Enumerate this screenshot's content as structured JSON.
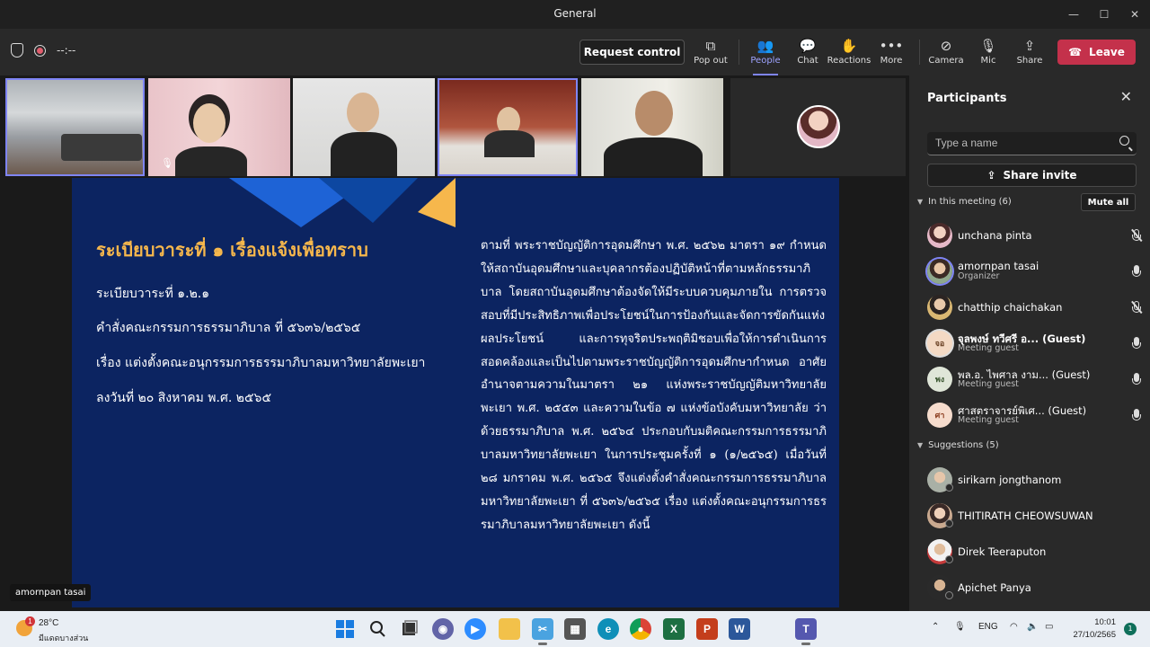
{
  "window": {
    "title": "General"
  },
  "toolbar": {
    "timer": "--:--",
    "request_control": "Request control",
    "buttons": [
      {
        "label": "Pop out",
        "icon": "popout-icon"
      },
      {
        "label": "People",
        "icon": "people-icon"
      },
      {
        "label": "Chat",
        "icon": "chat-icon"
      },
      {
        "label": "Reactions",
        "icon": "reactions-icon"
      },
      {
        "label": "More",
        "icon": "more-icon"
      },
      {
        "label": "Camera",
        "icon": "camera-off-icon"
      },
      {
        "label": "Mic",
        "icon": "mic-off-icon"
      },
      {
        "label": "Share",
        "icon": "share-icon"
      }
    ],
    "leave": "Leave",
    "accent": "#7f85f5",
    "leave_color": "#c4314b"
  },
  "stage": {
    "presenter_label": "amornpan tasai",
    "slide": {
      "title": "ระเบียบวาระที่ ๑ เรื่องแจ้งเพื่อทราบ",
      "lines": [
        "ระเบียบวาระที่ ๑.๒.๑",
        "คำสั่งคณะกรรมการธรรมาภิบาล ที่ ๕๖๓๖/๒๕๖๕",
        "เรื่อง แต่งตั้งคณะอนุกรรมการธรรมาภิบาลมหาวิทยาลัยพะเยา",
        "ลงวันที่ ๒๐ สิงหาคม พ.ศ. ๒๕๖๕"
      ],
      "paragraph": "ตามที่ พระราชบัญญัติการอุดมศึกษา พ.ศ. ๒๕๖๒ มาตรา ๑๙ กำหนดให้สถาบันอุดมศึกษาและบุคลากรต้องปฏิบัติหน้าที่ตามหลักธรรมาภิบาล โดยสถาบันอุดมศึกษาต้องจัดให้มีระบบควบคุมภายใน การตรวจสอบที่มีประสิทธิภาพเพื่อประโยชน์ในการป้องกันและจัดการขัดกันแห่งผลประโยชน์ และการทุจริตประพฤติมิชอบเพื่อให้การดำเนินการสอดคล้องและเป็นไปตามพระราชบัญญัติการอุดมศึกษากำหนด อาศัยอำนาจตามความในมาตรา ๒๑ แห่งพระราชบัญญัติมหาวิทยาลัยพะเยา พ.ศ. ๒๕๕๓ และความในข้อ ๗ แห่งข้อบังคับมหาวิทยาลัย ว่าด้วยธรรมาภิบาล พ.ศ. ๒๕๖๔ ประกอบกับมติคณะกรรมการธรรมาภิบาลมหาวิทยาลัยพะเยา ในการประชุมครั้งที่ ๑ (๑/๒๕๖๕) เมื่อวันที่ ๒๘ มกราคม พ.ศ. ๒๕๖๕ จึงแต่งตั้งคำสั่งคณะกรรมการธรรมาภิบาลมหาวิทยาลัยพะเยา ที่ ๕๖๓๖/๒๕๖๕ เรื่อง แต่งตั้งคณะอนุกรรมการธรรมาภิบาลมหาวิทยาลัยพะเยา ดังนี้",
      "title_color": "#f6b74c",
      "background": "#0c2461"
    }
  },
  "panel": {
    "title": "Participants",
    "search_placeholder": "Type a name",
    "share_invite": "Share invite",
    "in_meeting_header": "In this meeting (6)",
    "mute_all": "Mute all",
    "participants": [
      {
        "name": "unchana pinta",
        "sub": "",
        "initials": "",
        "mic": "off"
      },
      {
        "name": "amornpan tasai",
        "sub": "Organizer",
        "initials": "",
        "mic": "on"
      },
      {
        "name": "chatthip chaichakan",
        "sub": "",
        "initials": "",
        "mic": "off"
      },
      {
        "name": "จุลพงษ์ ทวีศรี อ...  (Guest)",
        "sub": "Meeting guest",
        "initials": "จอ",
        "mic": "on"
      },
      {
        "name": "พล.อ. ไพศาล งาม...  (Guest)",
        "sub": "Meeting guest",
        "initials": "พง",
        "mic": "on"
      },
      {
        "name": "ศาสตราจารย์พิเศ...  (Guest)",
        "sub": "Meeting guest",
        "initials": "ศา",
        "mic": "on"
      }
    ],
    "suggestions_header": "Suggestions (5)",
    "suggestions": [
      {
        "name": "sirikarn jongthanom"
      },
      {
        "name": "THITIRATH CHEOWSUWAN"
      },
      {
        "name": "Direk Teeraputon"
      },
      {
        "name": "Apichet Panya"
      }
    ]
  },
  "taskbar": {
    "weather_temp": "28°C",
    "weather_cond": "มีแดดบางส่วน",
    "weather_badge": "1",
    "lang": "ENG",
    "time": "10:01",
    "date": "27/10/2565",
    "notifications": "1",
    "apps": [
      {
        "name": "start-icon",
        "color": "#1a7ce0"
      },
      {
        "name": "search-icon",
        "color": "#222222"
      },
      {
        "name": "task-view-icon",
        "color": "#333333"
      },
      {
        "name": "chat-app-icon",
        "color": "#6264a7"
      },
      {
        "name": "zoom-icon",
        "color": "#2d8cff"
      },
      {
        "name": "file-explorer-icon",
        "color": "#f2c14a"
      },
      {
        "name": "snipping-tool-icon",
        "color": "#4aa3e0"
      },
      {
        "name": "calculator-icon",
        "color": "#555555"
      },
      {
        "name": "edge-icon",
        "color": "#0f8fb8"
      },
      {
        "name": "chrome-icon",
        "color": "#db4437"
      },
      {
        "name": "excel-icon",
        "color": "#1d6f42"
      },
      {
        "name": "powerpoint-icon",
        "color": "#c43e1c"
      },
      {
        "name": "word-icon",
        "color": "#2b579a"
      },
      {
        "name": "teams-icon",
        "color": "#5558af"
      }
    ]
  }
}
